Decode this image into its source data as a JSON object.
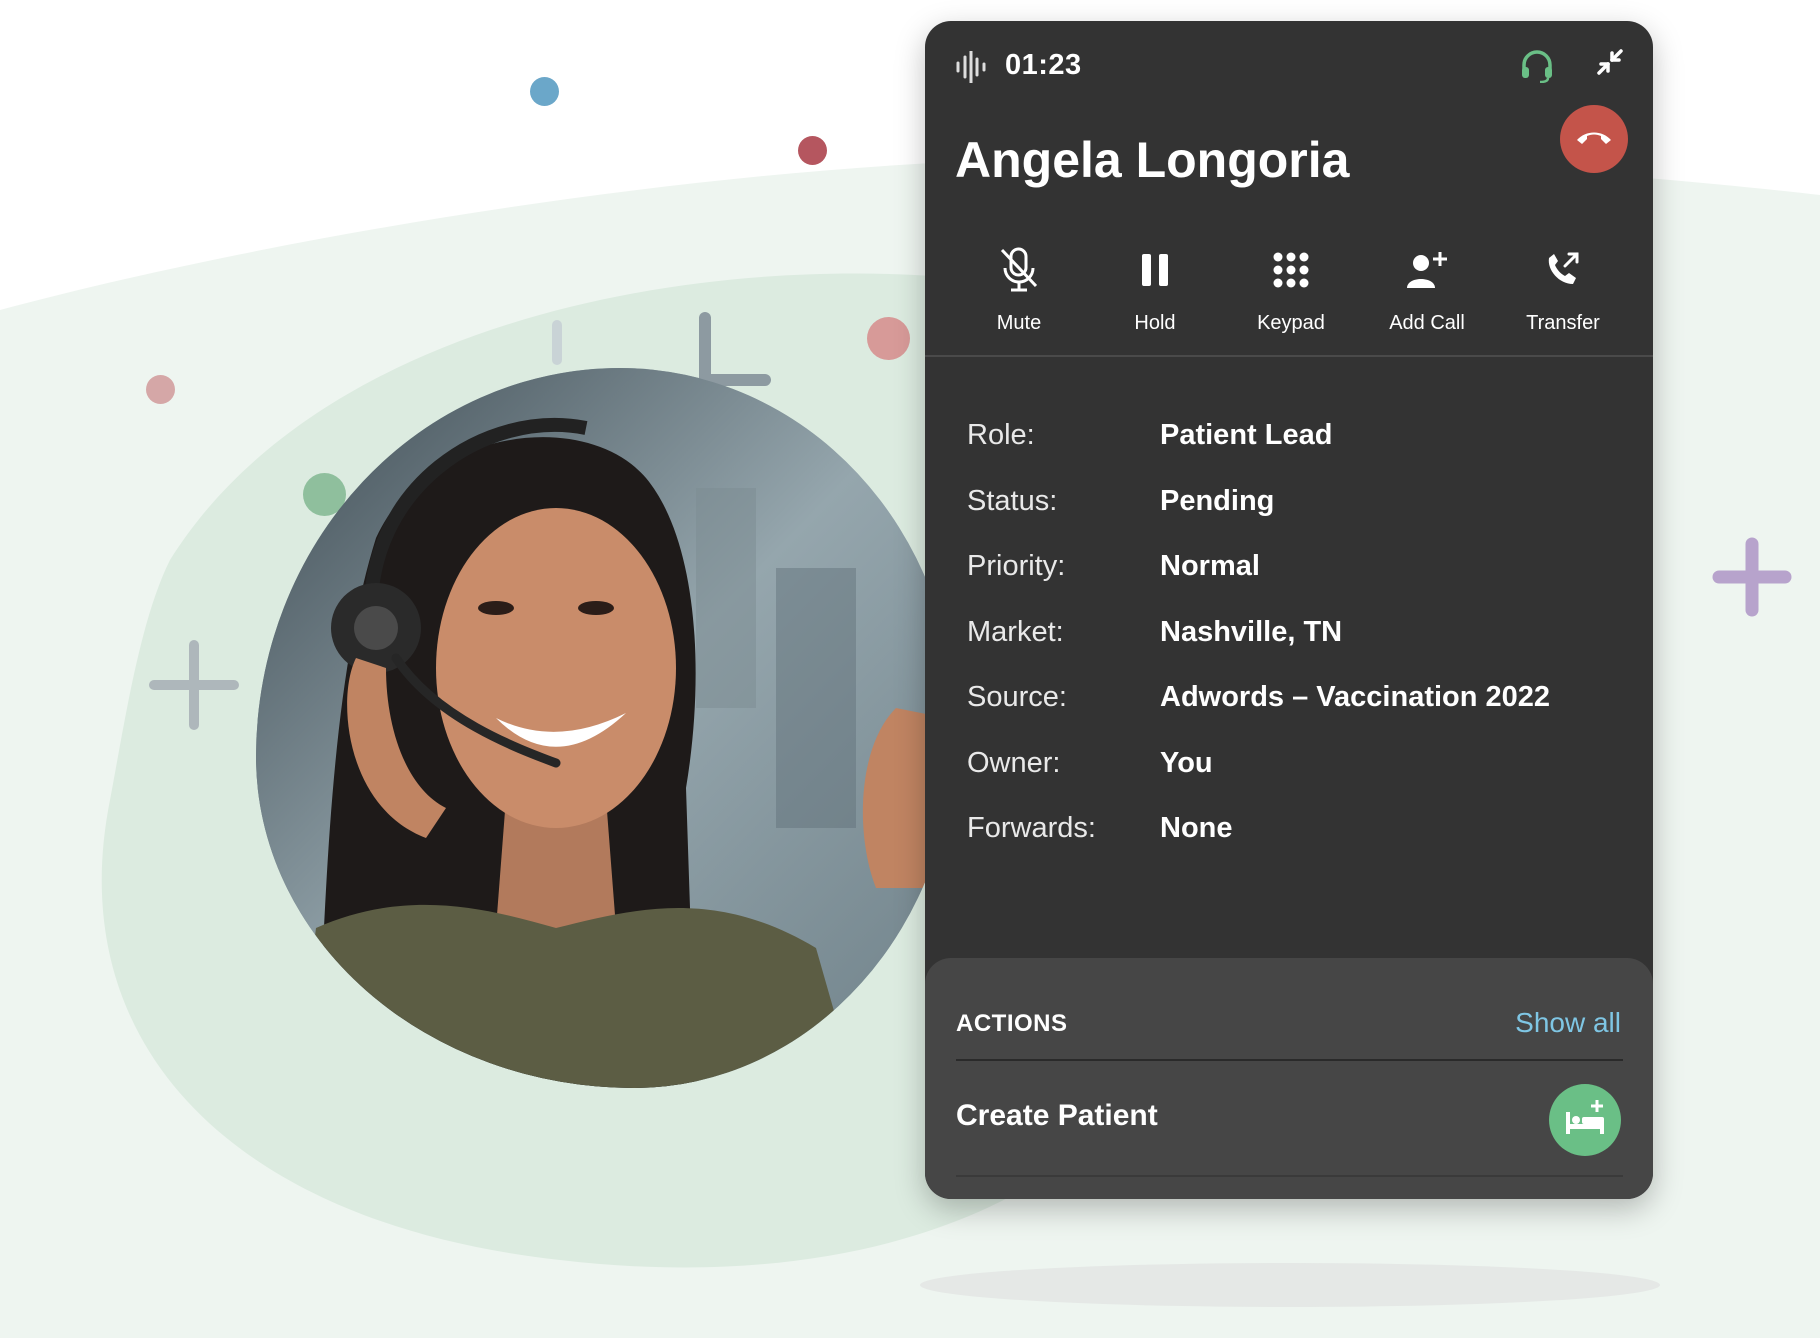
{
  "call": {
    "timer": "01:23",
    "caller_name": "Angela Longoria"
  },
  "controls": [
    {
      "label": "Mute",
      "icon": "mic-off-icon"
    },
    {
      "label": "Hold",
      "icon": "pause-icon"
    },
    {
      "label": "Keypad",
      "icon": "keypad-icon"
    },
    {
      "label": "Add Call",
      "icon": "add-person-icon"
    },
    {
      "label": "Transfer",
      "icon": "call-transfer-icon"
    }
  ],
  "details": [
    {
      "label": "Role:",
      "value": "Patient Lead"
    },
    {
      "label": "Status:",
      "value": "Pending"
    },
    {
      "label": "Priority:",
      "value": "Normal"
    },
    {
      "label": "Market:",
      "value": "Nashville, TN"
    },
    {
      "label": "Source:",
      "value": "Adwords – Vaccination 2022"
    },
    {
      "label": "Owner:",
      "value": "You"
    },
    {
      "label": "Forwards:",
      "value": "None"
    }
  ],
  "actions": {
    "title": "ACTIONS",
    "show_all": "Show all",
    "items": [
      {
        "label": "Create Patient",
        "icon": "hospital-bed-plus-icon"
      }
    ]
  },
  "colors": {
    "widget_bg": "#333333",
    "actions_bg": "#464646",
    "hangup": "#c4544a",
    "accent_green": "#6abf86",
    "link_blue": "#7fc6e4"
  }
}
